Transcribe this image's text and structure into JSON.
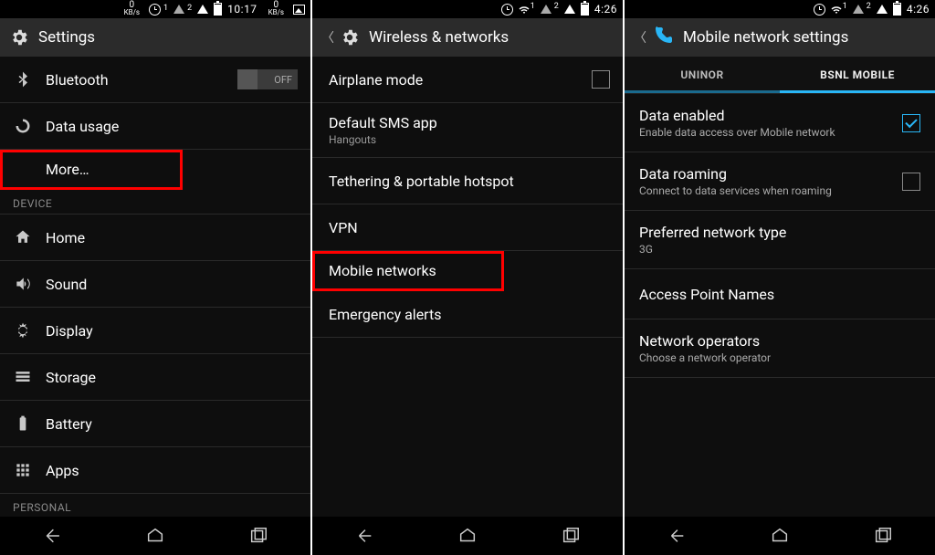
{
  "status": {
    "kbs": "0",
    "kbs_unit": "KB/s",
    "sim1": "1",
    "sim2": "2",
    "time1": "10:17",
    "time2": "4:26",
    "time3": "4:26"
  },
  "pane1": {
    "title": "Settings",
    "rows": {
      "bluetooth": "Bluetooth",
      "bt_toggle": "OFF",
      "data_usage": "Data usage",
      "more": "More…",
      "cat_device": "DEVICE",
      "home": "Home",
      "sound": "Sound",
      "display": "Display",
      "storage": "Storage",
      "battery": "Battery",
      "apps": "Apps",
      "cat_personal": "PERSONAL"
    }
  },
  "pane2": {
    "title": "Wireless & networks",
    "rows": {
      "airplane": "Airplane mode",
      "sms": "Default SMS app",
      "sms_sub": "Hangouts",
      "tether": "Tethering & portable hotspot",
      "vpn": "VPN",
      "mobile": "Mobile networks",
      "alerts": "Emergency alerts"
    }
  },
  "pane3": {
    "title": "Mobile network settings",
    "tabs": {
      "a": "UNINOR",
      "b": "BSNL MOBILE"
    },
    "rows": {
      "data": "Data enabled",
      "data_sub": "Enable data access over Mobile network",
      "roam": "Data roaming",
      "roam_sub": "Connect to data services when roaming",
      "pref": "Preferred network type",
      "pref_sub": "3G",
      "apn": "Access Point Names",
      "ops": "Network operators",
      "ops_sub": "Choose a network operator"
    }
  }
}
